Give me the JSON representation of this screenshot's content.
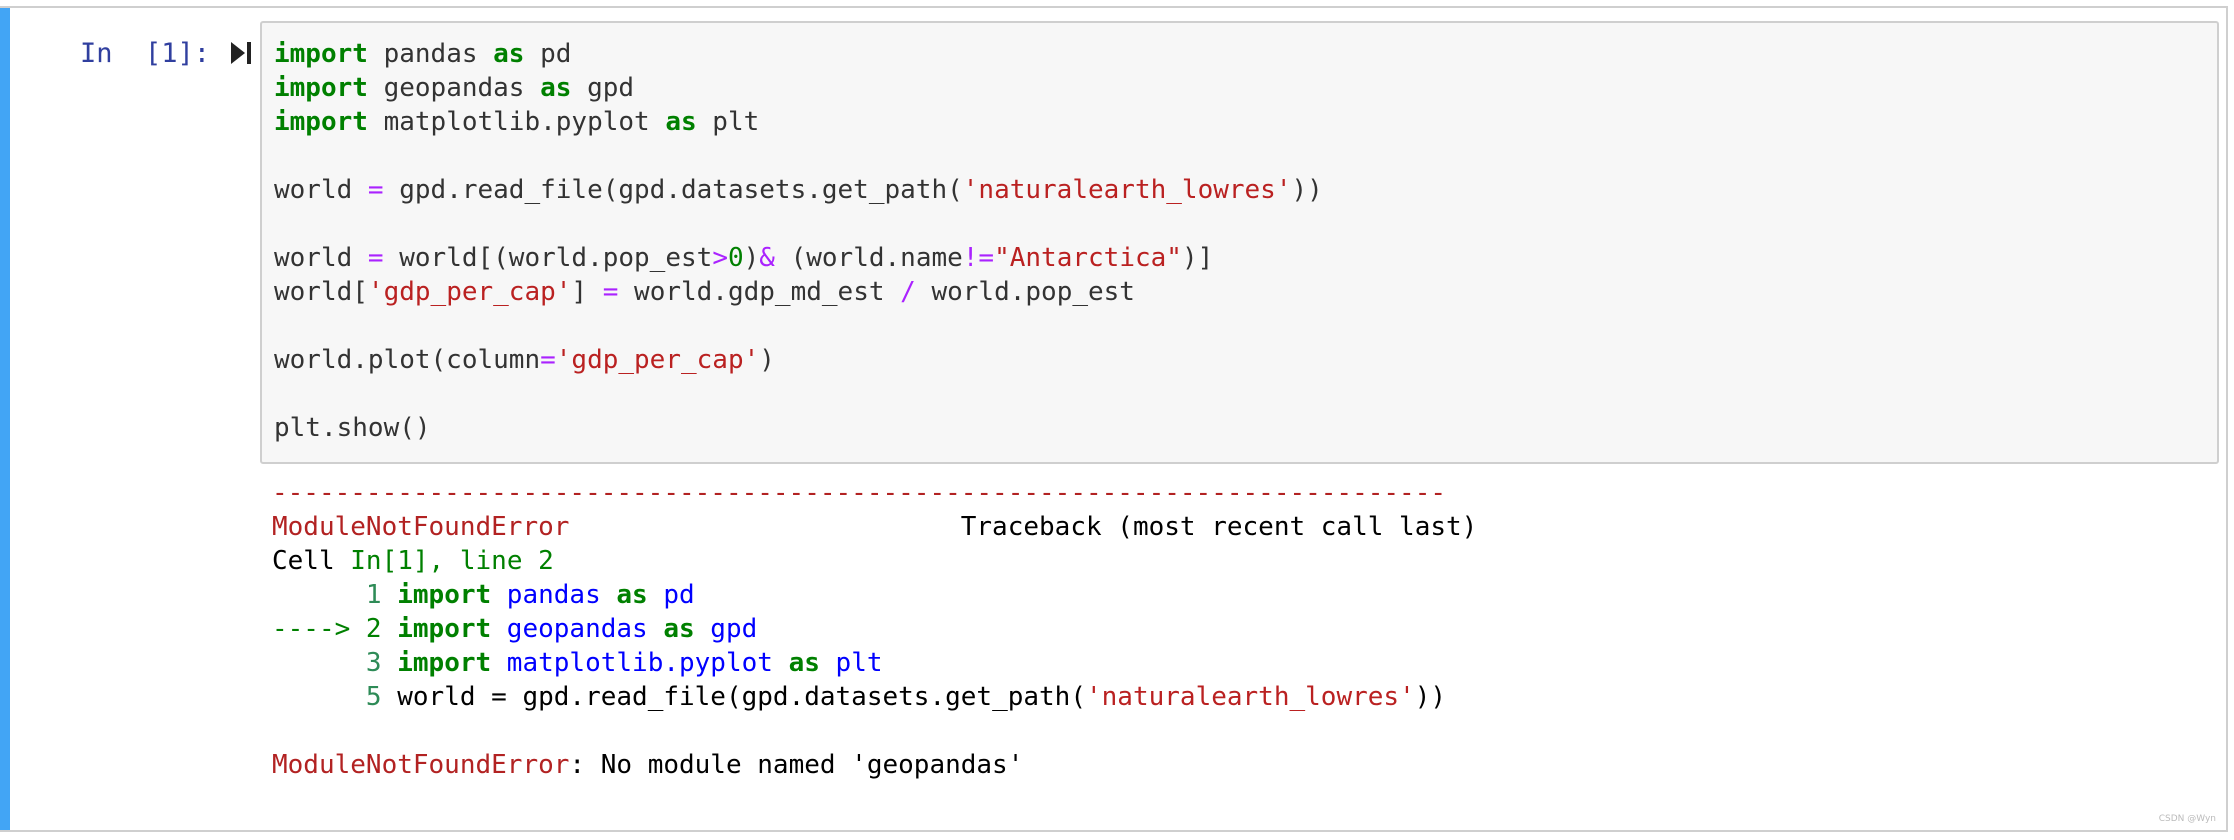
{
  "cell": {
    "prompt": "In  [1]:",
    "run_icon": "run-cell-icon",
    "accent_color": "#42a5f5"
  },
  "code": {
    "l1_kw": "import",
    "l1_mod": " pandas ",
    "l1_as": "as",
    "l1_alias": " pd",
    "l2_kw": "import",
    "l2_mod": " geopandas ",
    "l2_as": "as",
    "l2_alias": " gpd",
    "l3_kw": "import",
    "l3_mod": " matplotlib.pyplot ",
    "l3_as": "as",
    "l3_alias": " plt",
    "l5_a": "world ",
    "l5_eq": "=",
    "l5_b": " gpd.read_file(gpd.datasets.get_path(",
    "l5_str": "'naturalearth_lowres'",
    "l5_c": "))",
    "l7_a": "world ",
    "l7_eq": "=",
    "l7_b": " world[(world.pop_est",
    "l7_gt": ">",
    "l7_zero": "0",
    "l7_c": ")",
    "l7_amp": "&",
    "l7_d": " (world.name",
    "l7_ne": "!=",
    "l7_str": "\"Antarctica\"",
    "l7_e": ")]",
    "l8_a": "world[",
    "l8_str": "'gdp_per_cap'",
    "l8_b": "] ",
    "l8_eq": "=",
    "l8_c": " world.gdp_md_est ",
    "l8_div": "/",
    "l8_d": " world.pop_est",
    "l10_a": "world.plot(column",
    "l10_eq": "=",
    "l10_str": "'gdp_per_cap'",
    "l10_b": ")",
    "l12": "plt.show()"
  },
  "output": {
    "dashes": "---------------------------------------------------------------------------",
    "error_name": "ModuleNotFoundError",
    "traceback_header": "                         Traceback (most recent call last)",
    "cell_ref_a": "Cell ",
    "cell_ref_in": "In[1], line 2",
    "tb1_ln": "      1 ",
    "tb1_kw": "import",
    "tb1_mod": " pandas ",
    "tb1_as": "as",
    "tb1_alias": " pd",
    "tb2_arrow": "----> 2 ",
    "tb2_kw": "import",
    "tb2_mod": " geopandas ",
    "tb2_as": "as",
    "tb2_alias": " gpd",
    "tb3_ln": "      3 ",
    "tb3_kw": "import",
    "tb3_mod": " matplotlib.pyplot ",
    "tb3_as": "as",
    "tb3_alias": " plt",
    "tb5_ln": "      5 ",
    "tb5_a": "world ",
    "tb5_eq": "=",
    "tb5_b": " gpd.read_file(gpd.datasets.get_path(",
    "tb5_str": "'naturalearth_lowres'",
    "tb5_c": "))",
    "final_err": "ModuleNotFoundError",
    "final_msg": ": No module named 'geopandas'"
  },
  "watermark": "CSDN @Wyn"
}
